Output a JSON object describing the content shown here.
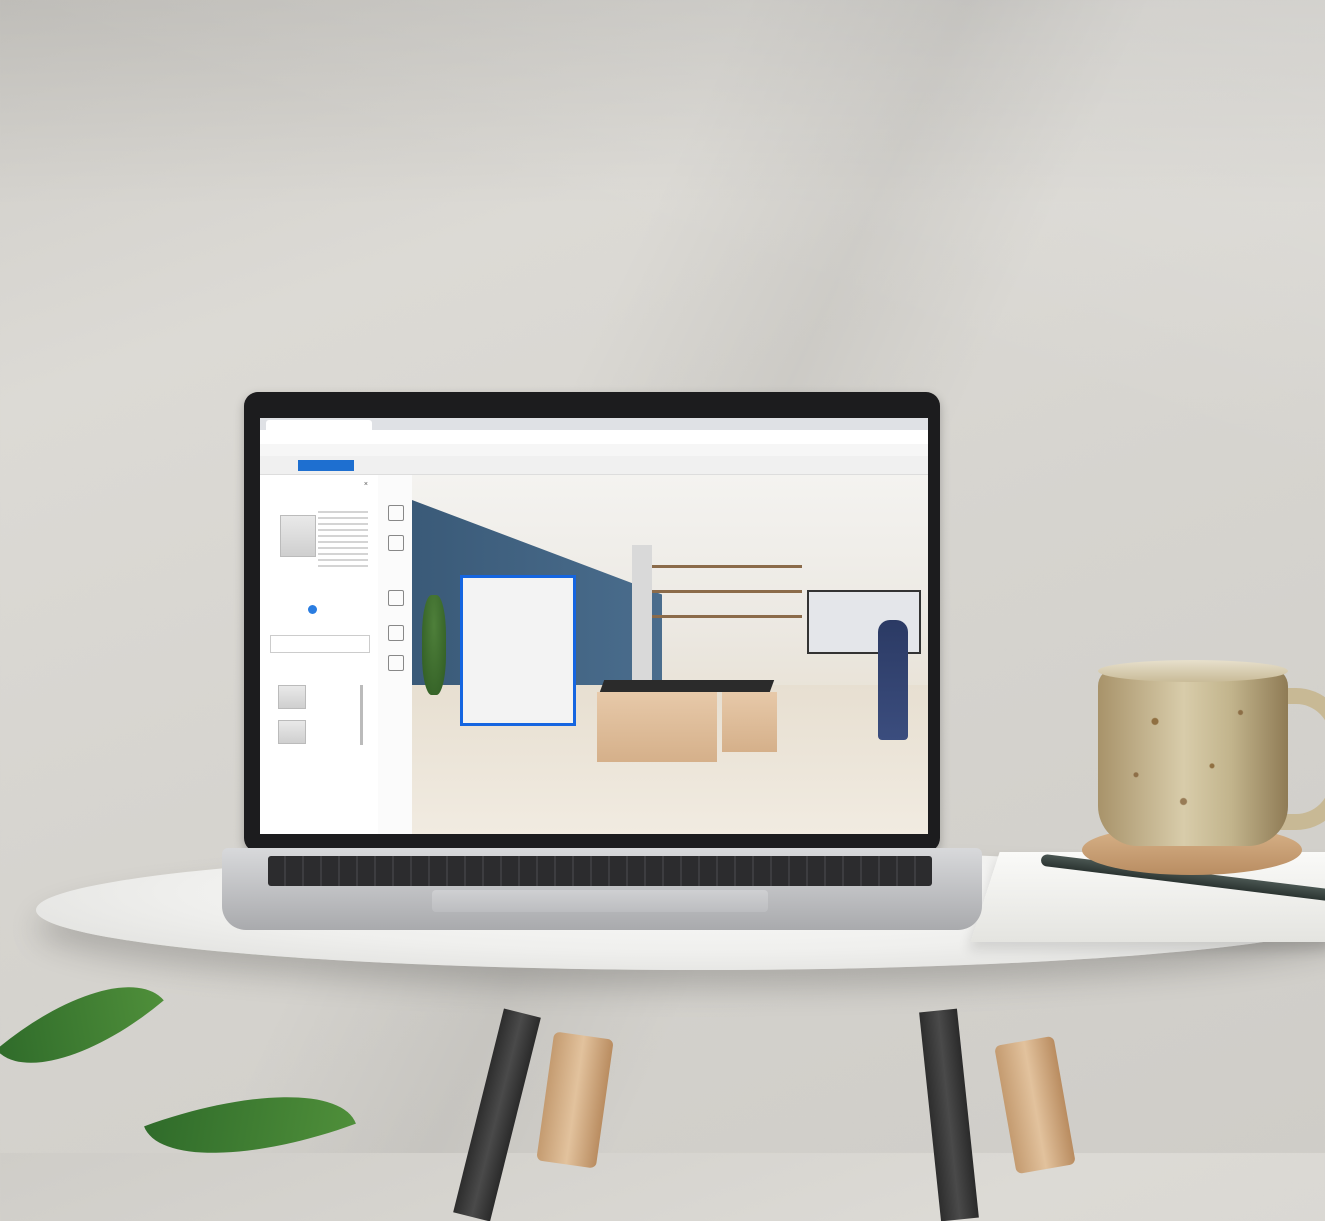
{
  "scene": {
    "description_free": true
  },
  "browser": {
    "tab_title": "",
    "url": ""
  },
  "app": {
    "breadcrumb": "",
    "steps": [
      "",
      "",
      ""
    ],
    "active_step": 1
  },
  "colors": {
    "wall": "#d6d4cf",
    "accent_blue": "#1565e0",
    "viewport_wall": "#3a5a78",
    "bench_wood": "#d5b08a"
  },
  "icons": [
    "close-icon",
    "zoom-in-icon",
    "zoom-out-icon",
    "rotate-icon",
    "copy-icon",
    "delete-icon"
  ]
}
